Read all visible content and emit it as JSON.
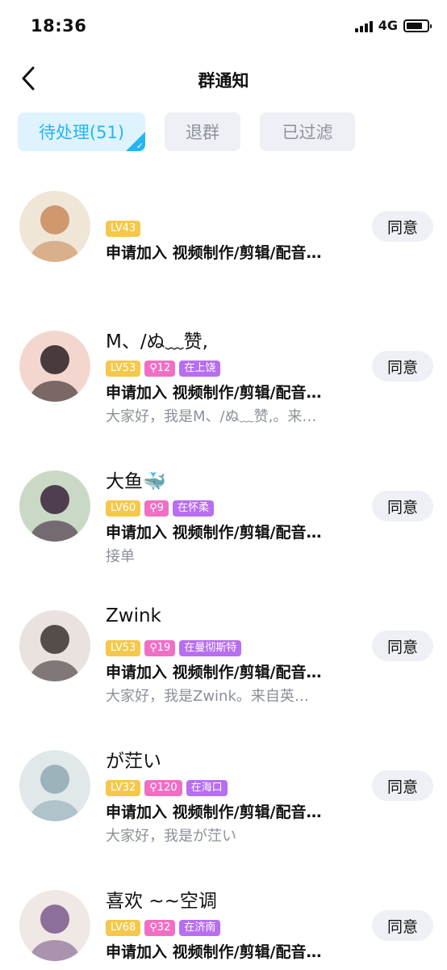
{
  "status_bar": {
    "time": "18:36",
    "network": "4G",
    "battery_level": 0.8
  },
  "nav": {
    "title": "群通知"
  },
  "tabs": [
    {
      "label": "待处理(51)",
      "active": true
    },
    {
      "label": "退群",
      "active": false
    },
    {
      "label": "已过滤",
      "active": false
    }
  ],
  "requests": [
    {
      "name": "",
      "level": "LV43",
      "count": "",
      "location": "",
      "request": "申请加入 视频制作/剪辑/配音…",
      "note": "",
      "action": "同意",
      "avatar_colors": [
        "#c98a5a",
        "#efe6d8"
      ]
    },
    {
      "name": "M、/ぬ﹏赞,",
      "level": "LV53",
      "count": "⚲12",
      "location": "在上饶",
      "request": "申请加入 视频制作/剪辑/配音…",
      "note": "大家好，我是M、/ぬ﹏赞,。来…",
      "action": "同意",
      "avatar_colors": [
        "#2a1e22",
        "#f3d7cf"
      ]
    },
    {
      "name": "大鱼🐳",
      "level": "LV60",
      "count": "⚲9",
      "location": "在怀柔",
      "request": "申请加入 视频制作/剪辑/配音…",
      "note": "接单",
      "action": "同意",
      "avatar_colors": [
        "#3a2238",
        "#c9d9c6"
      ]
    },
    {
      "name": "Zwink",
      "level": "LV53",
      "count": "⚲19",
      "location": "在曼彻斯特",
      "request": "申请加入 视频制作/剪辑/配音…",
      "note": "大家好，我是Zwink。来自英…",
      "action": "同意",
      "avatar_colors": [
        "#3a3230",
        "#e9e2df"
      ]
    },
    {
      "name": "が茳い",
      "level": "LV32",
      "count": "⚲120",
      "location": "在海口",
      "request": "申请加入 视频制作/剪辑/配音…",
      "note": "大家好，我是が茳い",
      "action": "同意",
      "avatar_colors": [
        "#8fa9b4",
        "#e1e8ea"
      ]
    },
    {
      "name": "喜欢 ~~空调",
      "level": "LV68",
      "count": "⚲32",
      "location": "在济南",
      "request": "申请加入 视频制作/剪辑/配音…",
      "note": "",
      "action": "同意",
      "avatar_colors": [
        "#7a5a8c",
        "#f0e8e4"
      ]
    }
  ],
  "icons": {
    "back": "chevron-left-icon",
    "check": "check-icon"
  },
  "colors": {
    "accent": "#22b6f5",
    "level_tag": "#f5c84a",
    "pink_tag": "#f06fc5",
    "location_tag": "#b76ef0"
  }
}
